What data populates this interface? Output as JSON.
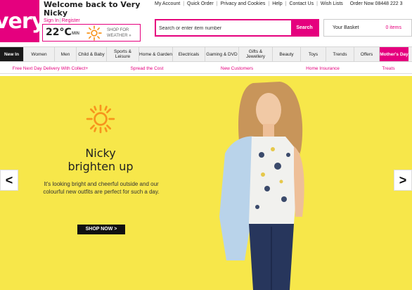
{
  "brand": {
    "logo_text": "very",
    "accent": "#e5007e"
  },
  "welcome": {
    "title": "Welcome back to Very Nicky",
    "sign_in": "Sign In",
    "separator": "|",
    "register": "Register"
  },
  "weather": {
    "temp": "22°C",
    "min_label": "MIN",
    "shop_label_1": "SHOP FOR",
    "shop_label_2": "WEATHER",
    "icon": "sun-icon"
  },
  "topnav": {
    "my_account": "My Account",
    "quick_order": "Quick Order",
    "privacy": "Privacy and Cookies",
    "help": "Help",
    "contact": "Contact Us",
    "wish_lists": "Wish Lists",
    "order_now": "Order Now 08448 222 3"
  },
  "search": {
    "placeholder": "Search or enter item number",
    "button": "Search"
  },
  "basket": {
    "label": "Your Basket",
    "count": "0 items"
  },
  "categories": [
    "New In",
    "Women",
    "Men",
    "Child & Baby",
    "Sports & Leisure",
    "Home & Garden",
    "Electricals",
    "Gaming & DVD",
    "Gifts & Jewellery",
    "Beauty",
    "Toys",
    "Trends",
    "Offers",
    "Mother's Day"
  ],
  "promos": [
    "Free Next Day Delivery With Collect+",
    "Spread the Cost",
    "New Customers",
    "Home Insurance",
    "Treats"
  ],
  "hero": {
    "headline_1": "Nicky",
    "headline_2": "brighten up",
    "body": "It's looking bright and cheerful outside and our colourful new outfits are perfect for such a day.",
    "cta": "SHOP NOW >",
    "background": "#f7e74a",
    "prev": "<",
    "next": ">"
  }
}
